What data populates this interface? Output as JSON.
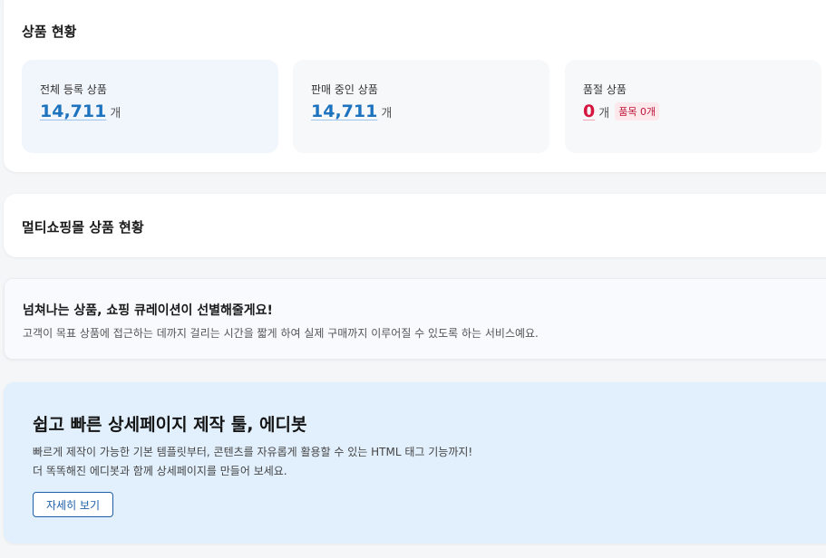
{
  "product_status": {
    "title": "상품 현황",
    "stats": [
      {
        "label": "전체 등록 상품",
        "value": "14,711",
        "unit": "개"
      },
      {
        "label": "판매 중인 상품",
        "value": "14,711",
        "unit": "개"
      },
      {
        "label": "품절 상품",
        "value": "0",
        "unit": "개",
        "badge": "품목 0개"
      }
    ]
  },
  "multi_shop": {
    "title": "멀티쇼핑몰 상품 현황"
  },
  "curation": {
    "title": "넘쳐나는 상품, 쇼핑 큐레이션이 선별해줄게요!",
    "description": "고객이 목표 상품에 접근하는 데까지 걸리는 시간을 짧게 하여 실제 구매까지 이루어질 수 있도록 하는 서비스예요."
  },
  "editor_promo": {
    "title": "쉽고 빠른 상세페이지 제작 툴, 에디봇",
    "description_lines": [
      "빠르게 제작이 가능한 기본 템플릿부터, 콘텐츠를 자유롭게 활용할 수 있는 HTML 태그 기능까지!",
      "더 똑똑해진 에디봇과 함께 상세페이지를 만들어 보세요."
    ],
    "button_label": "자세히 보기"
  },
  "colors": {
    "accent": "#1e73be",
    "danger": "#d6163f",
    "promo_background": "#e2f0fd"
  }
}
